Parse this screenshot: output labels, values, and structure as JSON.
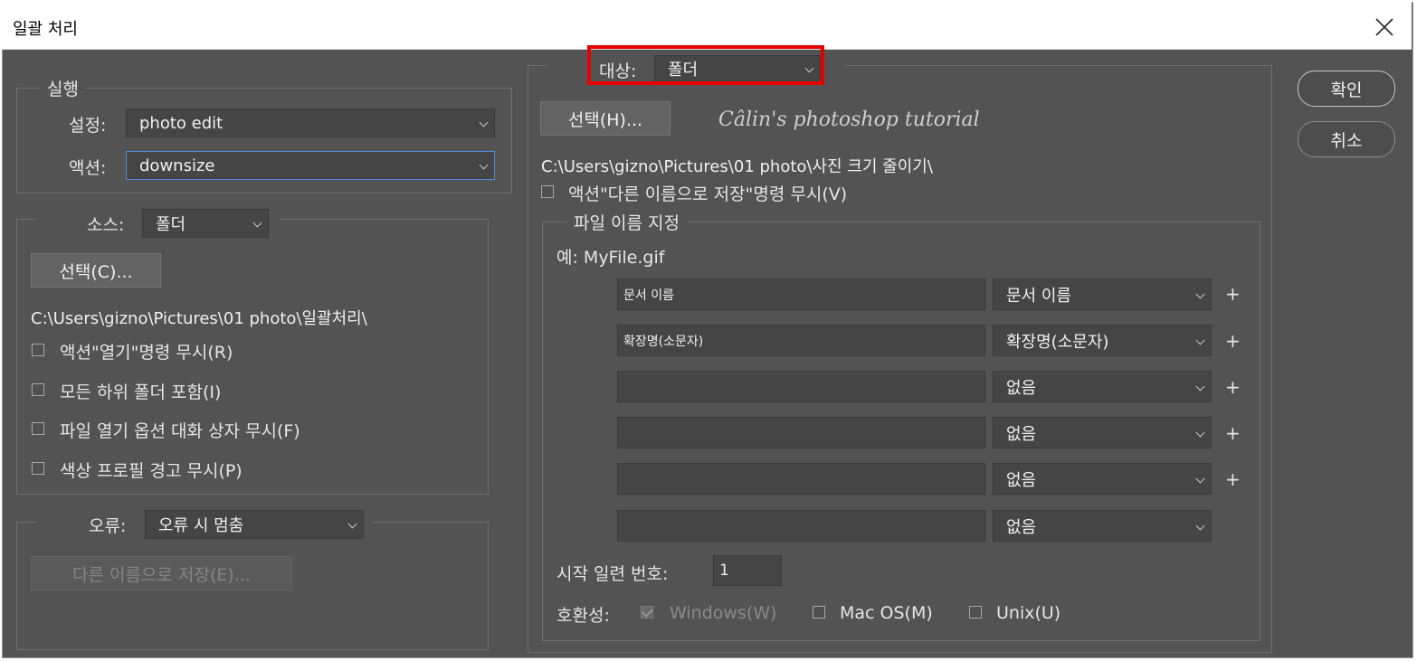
{
  "window": {
    "title": "일괄 처리"
  },
  "buttons": {
    "ok": "확인",
    "cancel": "취소"
  },
  "run": {
    "legend": "실행",
    "set_label": "설정:",
    "set_value": "photo edit",
    "action_label": "액션:",
    "action_value": "downsize"
  },
  "source": {
    "label": "소스:",
    "value": "폴더",
    "choose_button": "선택(C)...",
    "path": "C:\\Users\\gizno\\Pictures\\01  photo\\일괄처리\\",
    "checkboxes": [
      {
        "label": "액션\"열기\"명령 무시(R)",
        "checked": false
      },
      {
        "label": "모든 하위 폴더 포함(I)",
        "checked": false
      },
      {
        "label": "파일 열기 옵션 대화 상자 무시(F)",
        "checked": false
      },
      {
        "label": "색상 프로필 경고 무시(P)",
        "checked": false
      }
    ]
  },
  "errors": {
    "label": "오류:",
    "value": "오류 시 멈춤",
    "save_as_button": "다른 이름으로 저장(E)..."
  },
  "destination": {
    "label": "대상:",
    "value": "폴더",
    "choose_button": "선택(H)...",
    "path": "C:\\Users\\gizno\\Pictures\\01  photo\\사진 크기 줄이기\\",
    "override_label": "액션\"다른 이름으로 저장\"명령 무시(V)",
    "override_checked": false
  },
  "watermark": "Câlin's photoshop tutorial",
  "naming": {
    "legend": "파일 이름 지정",
    "example": "예: MyFile.gif",
    "rows": [
      {
        "field": "문서 이름",
        "select": "문서 이름",
        "plus": "+"
      },
      {
        "field": "확장명(소문자)",
        "select": "확장명(소문자)",
        "plus": "+"
      },
      {
        "field": "",
        "select": "없음",
        "plus": "+"
      },
      {
        "field": "",
        "select": "없음",
        "plus": "+"
      },
      {
        "field": "",
        "select": "없음",
        "plus": "+"
      },
      {
        "field": "",
        "select": "없음",
        "plus": ""
      }
    ],
    "serial_label": "시작 일련 번호:",
    "serial_value": "1",
    "compat_label": "호환성:",
    "compat": [
      {
        "label": "Windows(W)",
        "checked": true,
        "disabled": true
      },
      {
        "label": "Mac OS(M)",
        "checked": false,
        "disabled": false
      },
      {
        "label": "Unix(U)",
        "checked": false,
        "disabled": false
      }
    ]
  },
  "colors": {
    "panel": "#535353",
    "highlight": "#e60000",
    "focus": "#4c8cd9"
  }
}
